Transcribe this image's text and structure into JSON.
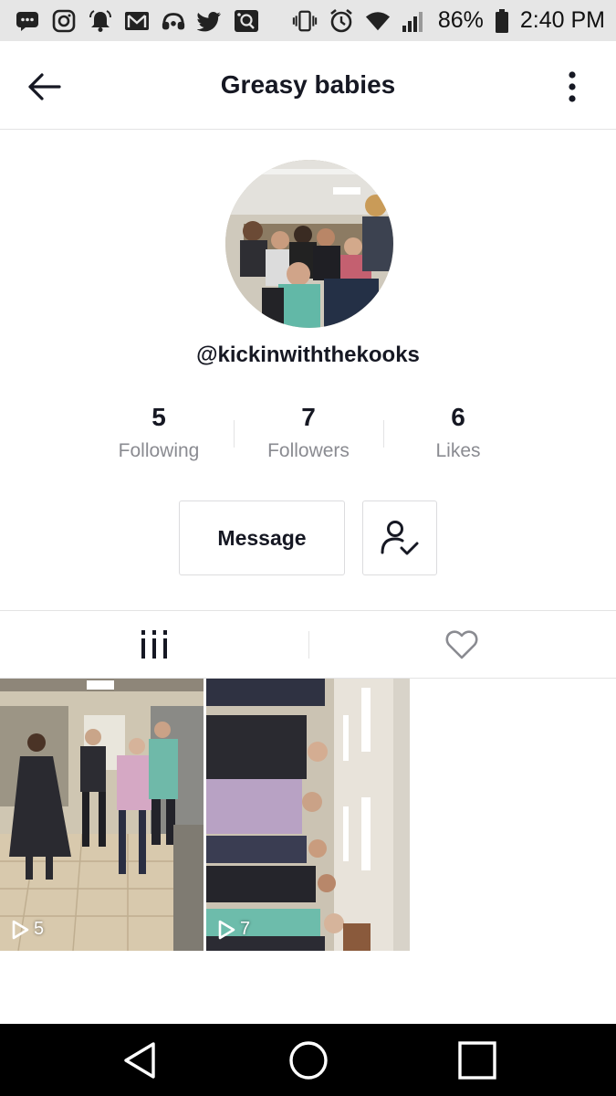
{
  "status_bar": {
    "battery": "86%",
    "time": "2:40 PM",
    "left_icons": [
      "messages-icon",
      "instagram-icon",
      "notification-bell-icon",
      "gmail-icon",
      "headset-icon",
      "twitter-icon",
      "photo-icon"
    ],
    "right_icons": [
      "vibrate-icon",
      "alarm-icon",
      "wifi-icon",
      "signal-icon",
      "battery-icon"
    ]
  },
  "header": {
    "title": "Greasy babies",
    "back_icon": "back-arrow-icon",
    "more_icon": "more-vertical-icon"
  },
  "profile": {
    "username": "@kickinwiththekooks",
    "stats": [
      {
        "value": "5",
        "label": "Following"
      },
      {
        "value": "7",
        "label": "Followers"
      },
      {
        "value": "6",
        "label": "Likes"
      }
    ],
    "message_label": "Message",
    "followed_icon": "user-check-icon"
  },
  "tabs": [
    {
      "name": "videos",
      "icon": "grid-icon",
      "active": true
    },
    {
      "name": "liked",
      "icon": "heart-icon",
      "active": false
    }
  ],
  "videos": [
    {
      "views": "5"
    },
    {
      "views": "7"
    }
  ],
  "colors": {
    "text_primary": "#161823",
    "text_secondary": "#8a8b91",
    "divider": "#e3e3e4",
    "status_bar": "#e6e6e6",
    "nav_bar": "#000000"
  }
}
